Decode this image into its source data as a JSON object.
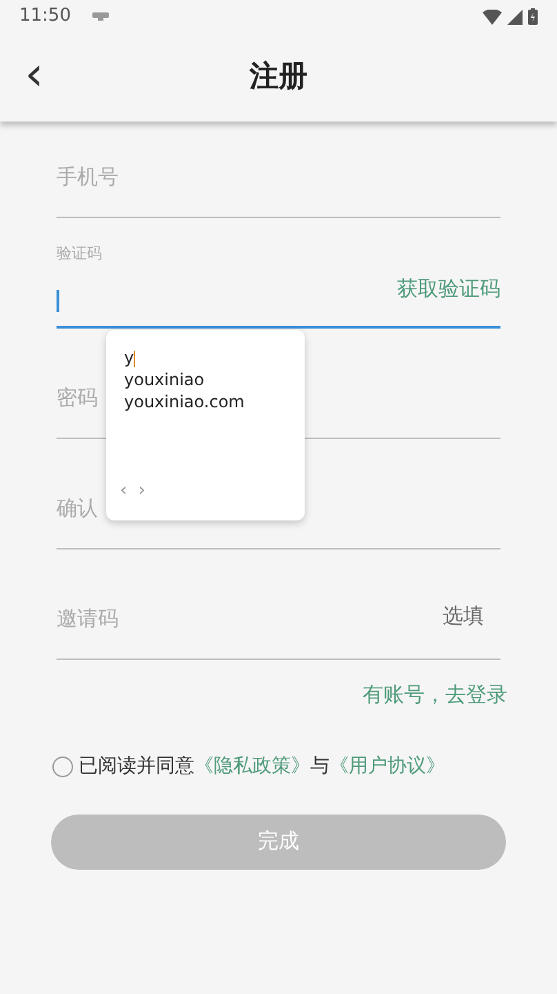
{
  "status_bar": {
    "time": "11:50"
  },
  "header": {
    "back": "‹",
    "title": "注册"
  },
  "fields": [
    {
      "kind": "plain",
      "placeholder": "手机号",
      "focused": false
    },
    {
      "kind": "code",
      "label": "验证码",
      "focused": true,
      "action": "获取验证码"
    },
    {
      "kind": "plain",
      "placeholder": "密码",
      "focused": false
    },
    {
      "kind": "plain",
      "placeholder": "确认",
      "focused": false
    },
    {
      "kind": "optional",
      "placeholder": "邀请码",
      "focused": false,
      "hint": "选填"
    }
  ],
  "login_link": "有账号，去登录",
  "agreement": {
    "checked": false,
    "text": "已阅读并同意",
    "link1": "《隐私政策》",
    "joiner": "与",
    "link2": "《用户协议》"
  },
  "submit": {
    "label": "完成",
    "disabled": true
  },
  "suggestions": {
    "typed": "y",
    "items": [
      "youxiniao",
      "youxiniao.com"
    ],
    "prev": "‹",
    "next": "›"
  }
}
